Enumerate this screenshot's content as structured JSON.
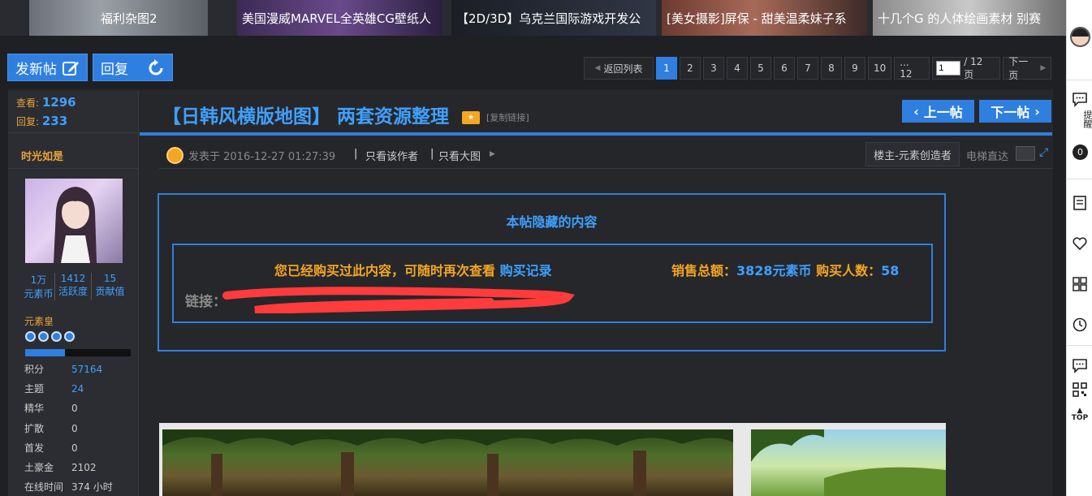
{
  "banner": {
    "items": [
      {
        "label": "福利杂图2"
      },
      {
        "label": "美国漫威MARVEL全英雄CG壁纸人"
      },
      {
        "label": "【2D/3D】乌克兰国际游戏开发公"
      },
      {
        "label": "[美女摄影]屏保 - 甜美温柔妹子系"
      },
      {
        "label": "十几个G 的人体绘画素材 别赛"
      }
    ]
  },
  "actions": {
    "new_post": "发新帖",
    "reply": "回复"
  },
  "pager": {
    "back": "返回列表",
    "pages": [
      "1",
      "2",
      "3",
      "4",
      "5",
      "6",
      "7",
      "8",
      "9",
      "10",
      "... 12"
    ],
    "current_page_value": "1",
    "total": "/ 12 页",
    "next": "下一页"
  },
  "stats": {
    "views_label": "查看:",
    "views": "1296",
    "replies_label": "回复:",
    "replies": "233"
  },
  "post": {
    "title": "【日韩风横版地图】 两套资源整理",
    "copy_link": "[复制链接]",
    "prev": "上一帖",
    "next": "下一帖",
    "posted_at": "发表于 2016-12-27 01:27:39",
    "only_author": "只看该作者",
    "only_big_image": "只看大图",
    "floor": "楼主-元素创造者",
    "elevator": "电梯直达"
  },
  "author": {
    "name": "时光如是",
    "counts": [
      {
        "value": "1万",
        "label": "元素币"
      },
      {
        "value": "1412",
        "label": "活跃度"
      },
      {
        "value": "15",
        "label": "贡献值"
      }
    ],
    "rank": "元素皇",
    "level_progress": 0.38,
    "fields": [
      {
        "k": "积分",
        "v": "57164",
        "blue": true
      },
      {
        "k": "主题",
        "v": "24",
        "blue": true
      },
      {
        "k": "精华",
        "v": "0",
        "blue": false
      },
      {
        "k": "扩散",
        "v": "0",
        "blue": false
      },
      {
        "k": "首发",
        "v": "0",
        "blue": false
      },
      {
        "k": "土豪金",
        "v": "2102",
        "blue": false
      },
      {
        "k": "在线时间",
        "v": "374 小时",
        "blue": false
      }
    ]
  },
  "hidden": {
    "title": "本帖隐藏的内容",
    "purchased": "您已经购买过此内容，可随时再次查看",
    "purchase_record": "购买记录",
    "sales_label": "销售总额：",
    "sales_value": "3828元素币",
    "buyers_label": "购买人数：",
    "buyers_value": "58",
    "link_label": "链接："
  },
  "sidebar": {
    "remind": "提醒",
    "remind_count": "0",
    "top": "TOP"
  },
  "colors": {
    "accent": "#2f7fe0",
    "link": "#3fa0ff",
    "orange": "#f5a623",
    "redact": "#ff3b3b"
  }
}
